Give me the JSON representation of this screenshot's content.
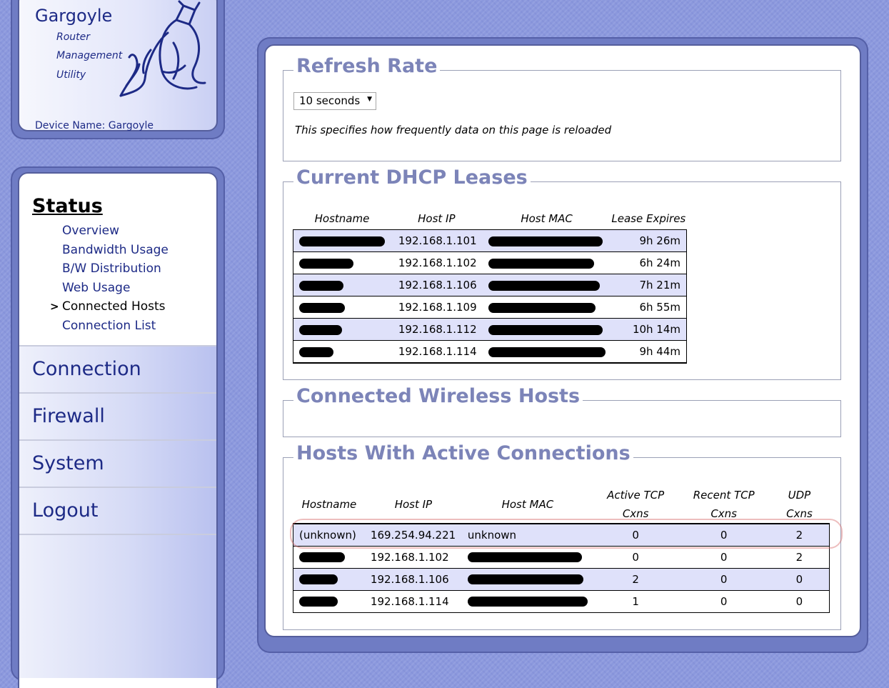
{
  "logo": {
    "app_title": "Gargoyle",
    "subtitle_lines": [
      "Router",
      "Management",
      "Utility"
    ],
    "device_name": "Device Name: Gargoyle"
  },
  "nav": {
    "status_heading": "Status",
    "status_items": [
      {
        "label": "Overview",
        "active": false
      },
      {
        "label": "Bandwidth Usage",
        "active": false
      },
      {
        "label": "B/W Distribution",
        "active": false
      },
      {
        "label": "Web Usage",
        "active": false
      },
      {
        "label": "Connected Hosts",
        "active": true
      },
      {
        "label": "Connection List",
        "active": false
      }
    ],
    "active_marker": ">",
    "main_items": [
      "Connection",
      "Firewall",
      "System",
      "Logout"
    ]
  },
  "refresh": {
    "title": "Refresh Rate",
    "selected": "10 seconds",
    "description": "This specifies how frequently data on this page is reloaded"
  },
  "dhcp": {
    "title": "Current DHCP Leases",
    "headers": [
      "Hostname",
      "Host IP",
      "Host MAC",
      "Lease Expires"
    ],
    "rows": [
      {
        "ip": "192.168.1.101",
        "expires": "9h 26m"
      },
      {
        "ip": "192.168.1.102",
        "expires": "6h 24m"
      },
      {
        "ip": "192.168.1.106",
        "expires": "7h 21m"
      },
      {
        "ip": "192.168.1.109",
        "expires": "6h 55m"
      },
      {
        "ip": "192.168.1.112",
        "expires": "10h 14m"
      },
      {
        "ip": "192.168.1.114",
        "expires": "9h 44m"
      }
    ]
  },
  "wireless": {
    "title": "Connected Wireless Hosts"
  },
  "active": {
    "title": "Hosts With Active Connections",
    "headers": [
      "Hostname",
      "Host IP",
      "Host MAC",
      "Active TCP",
      "Cxns",
      "Recent TCP",
      "Cxns",
      "UDP",
      "Cxns"
    ],
    "rows": [
      {
        "hostname": "(unknown)",
        "ip": "169.254.94.221",
        "mac": "unknown",
        "active_tcp": "0",
        "recent_tcp": "0",
        "udp": "2"
      },
      {
        "hostname": "",
        "ip": "192.168.1.102",
        "mac": "",
        "active_tcp": "0",
        "recent_tcp": "0",
        "udp": "2"
      },
      {
        "hostname": "",
        "ip": "192.168.1.106",
        "mac": "",
        "active_tcp": "2",
        "recent_tcp": "0",
        "udp": "0"
      },
      {
        "hostname": "",
        "ip": "192.168.1.114",
        "mac": "",
        "active_tcp": "1",
        "recent_tcp": "0",
        "udp": "0"
      }
    ]
  }
}
